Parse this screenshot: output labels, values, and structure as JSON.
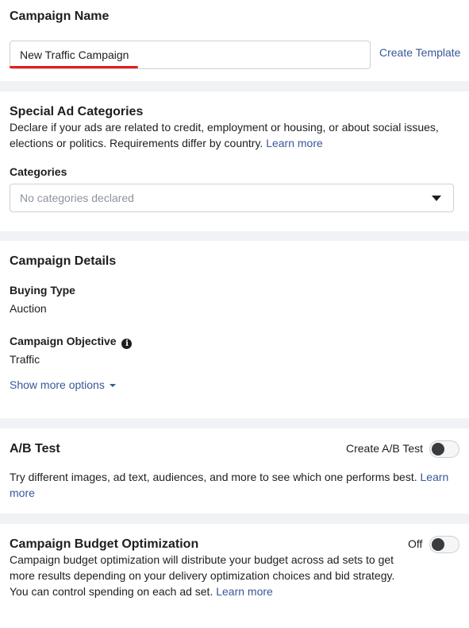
{
  "campaign_name": {
    "title": "Campaign Name",
    "value": "New Traffic Campaign",
    "create_template": "Create Template"
  },
  "special_ad_categories": {
    "title": "Special Ad Categories",
    "description": "Declare if your ads are related to credit, employment or housing, or about social issues, elections or politics. Requirements differ by country.",
    "learn_more": "Learn more",
    "categories_label": "Categories",
    "categories_placeholder": "No categories declared",
    "dropdown_icon": "caret-down-icon"
  },
  "campaign_details": {
    "title": "Campaign Details",
    "buying_type_label": "Buying Type",
    "buying_type_value": "Auction",
    "objective_label": "Campaign Objective",
    "objective_value": "Traffic",
    "info_icon": "info-icon",
    "show_more": "Show more options"
  },
  "ab_test": {
    "title": "A/B Test",
    "toggle_label": "Create A/B Test",
    "toggle_on": false,
    "description": "Try different images, ad text, audiences, and more to see which one performs best.",
    "learn_more": "Learn more"
  },
  "budget_optimization": {
    "title": "Campaign Budget Optimization",
    "toggle_label": "Off",
    "toggle_on": false,
    "description": "Campaign budget optimization will distribute your budget across ad sets to get more results depending on your delivery optimization choices and bid strategy. You can control spending on each ad set.",
    "learn_more": "Learn more"
  },
  "colors": {
    "link": "#385898",
    "underline_annotation": "#e41e1e",
    "page_bg": "#f0f2f5"
  }
}
